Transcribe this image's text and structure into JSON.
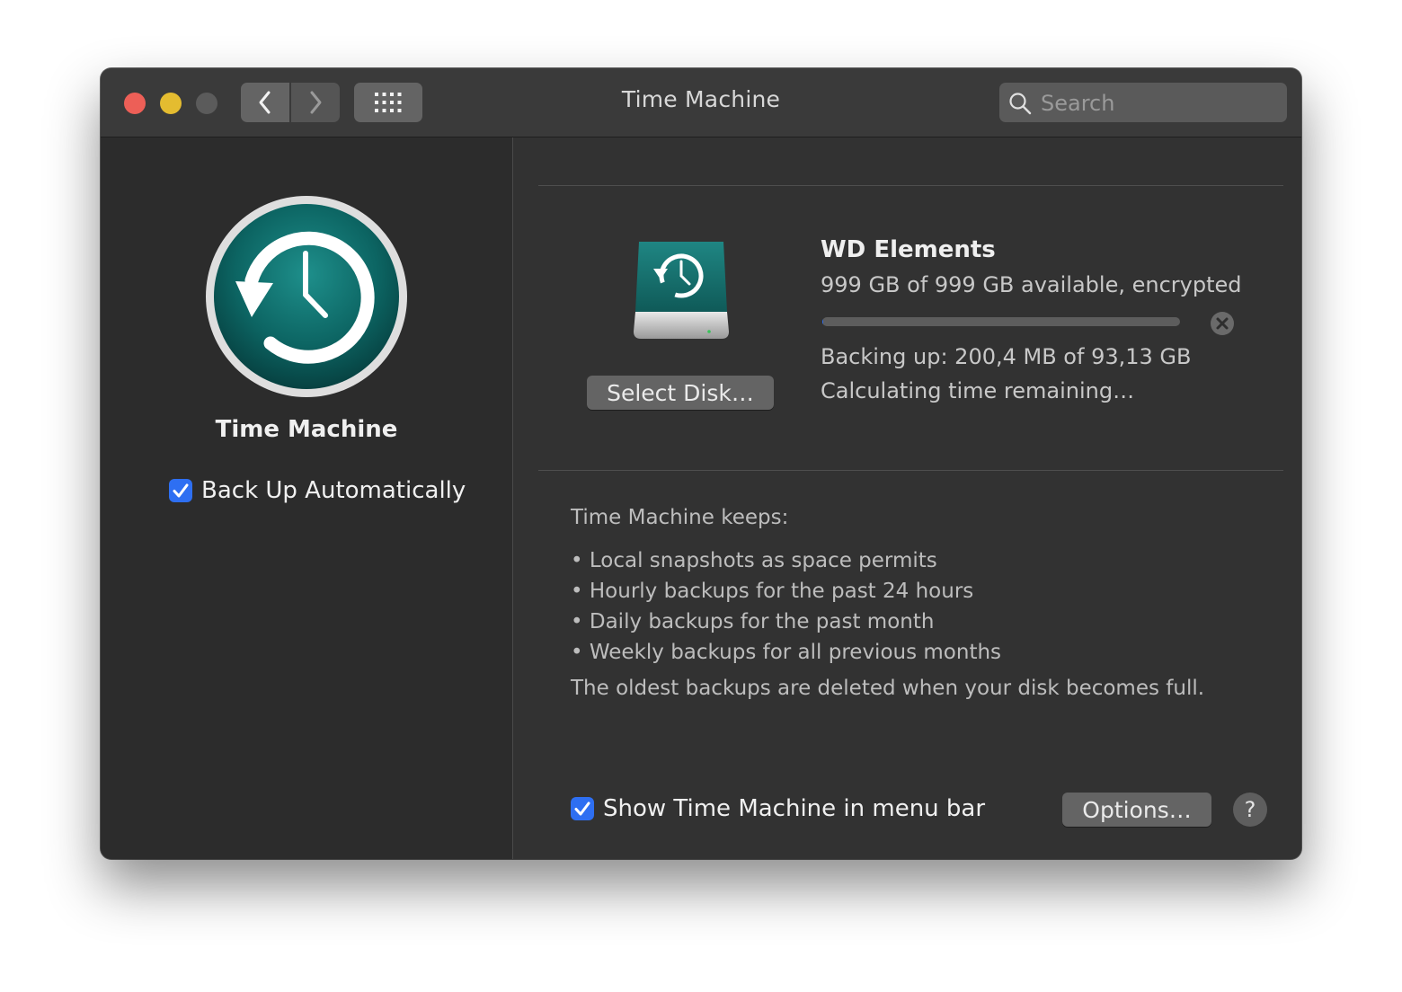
{
  "window": {
    "title": "Time Machine",
    "search_placeholder": "Search"
  },
  "sidebar": {
    "app_name": "Time Machine",
    "backup_auto_label": "Back Up Automatically",
    "backup_auto_checked": true
  },
  "disk": {
    "name": "WD Elements",
    "availability": "999 GB of 999 GB available, encrypted",
    "select_button": "Select Disk…",
    "progress_fraction": 0.002,
    "backing_up": "Backing up: 200,4 MB of 93,13 GB",
    "time_remaining": "Calculating time remaining…"
  },
  "keeps": {
    "title": "Time Machine keeps:",
    "items": [
      "• Local snapshots as space permits",
      "• Hourly backups for the past 24 hours",
      "• Daily backups for the past month",
      "• Weekly backups for all previous months"
    ],
    "note": "The oldest backups are deleted when your disk becomes full."
  },
  "footer": {
    "show_in_menubar_label": "Show Time Machine in menu bar",
    "show_in_menubar_checked": true,
    "options_button": "Options…",
    "help_button": "?"
  },
  "colors": {
    "accent": "#2e6ff2",
    "icon_teal": "#0f6a6a",
    "close_light": "#ed5f57",
    "minimize_light": "#e4bc30"
  },
  "icons": [
    "close-light",
    "minimize-light",
    "zoom-light",
    "chevron-left-icon",
    "chevron-right-icon",
    "grid-icon",
    "search-icon",
    "time-machine-icon",
    "external-disk-icon",
    "stop-icon",
    "checkmark-icon",
    "help-icon"
  ]
}
